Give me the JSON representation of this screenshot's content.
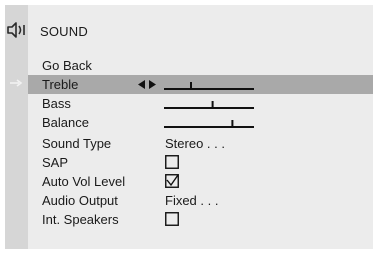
{
  "menu": {
    "title": "SOUND",
    "icons": {
      "header": "speaker-icon",
      "selection": "right-arrow-icon",
      "adjust": "left-right-arrows-icon"
    },
    "items": [
      {
        "label": "Go Back"
      },
      {
        "label": "Treble",
        "selected": true,
        "slider_level": 0.3
      },
      {
        "label": "Bass",
        "slider_level": 0.54
      },
      {
        "label": "Balance",
        "slider_level": 0.76
      },
      {
        "label": "Sound Type",
        "value": "Stereo . . ."
      },
      {
        "label": "SAP",
        "checked": false
      },
      {
        "label": "Auto Vol Level",
        "checked": true
      },
      {
        "label": "Audio Output",
        "value": "Fixed . . ."
      },
      {
        "label": "Int. Speakers",
        "checked": false
      }
    ]
  }
}
